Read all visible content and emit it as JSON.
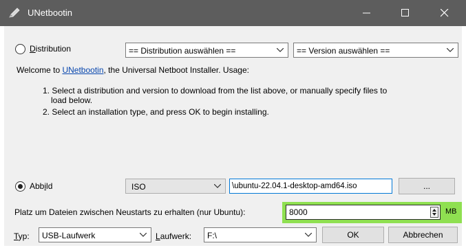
{
  "window": {
    "title": "UNetbootin",
    "icon": "pen-icon",
    "controls": [
      "minimize-icon",
      "maximize-icon",
      "close-icon"
    ]
  },
  "distribution": {
    "radio_label_mnemonic": "D",
    "radio_label_rest": "istribution",
    "radio_selected": false,
    "distribution_select": "== Distribution auswählen ==",
    "version_select": "== Version auswählen =="
  },
  "info": {
    "welcome_prefix": "Welcome to ",
    "welcome_link": "UNetbootin",
    "welcome_suffix": ", the Universal Netboot Installer. Usage:",
    "step1_line1": "1. Select a distribution and version to download from the list above, or manually specify files to",
    "step1_line2": "load below.",
    "step2": "2. Select an installation type, and press OK to begin installing."
  },
  "diskimage": {
    "radio_label_pre": "Abb",
    "radio_label_mnemonic": "i",
    "radio_label_post": "ld",
    "radio_selected": true,
    "type_select": "ISO",
    "path_value": "\\ubuntu-22.04.1-desktop-amd64.iso",
    "browse_label": "..."
  },
  "persistence": {
    "label": "Platz um Dateien zwischen Neustarts zu erhalten (nur Ubuntu):",
    "value": "8000",
    "unit": "MB",
    "highlight_color": "#8fe051"
  },
  "footer": {
    "type_label_mnemonic": "T",
    "type_label_rest": "yp:",
    "type_value": "USB-Laufwerk",
    "drive_label_mnemonic": "L",
    "drive_label_rest": "aufwerk:",
    "drive_value": "F:\\",
    "ok_label": "OK",
    "cancel_label": "Abbrechen"
  }
}
